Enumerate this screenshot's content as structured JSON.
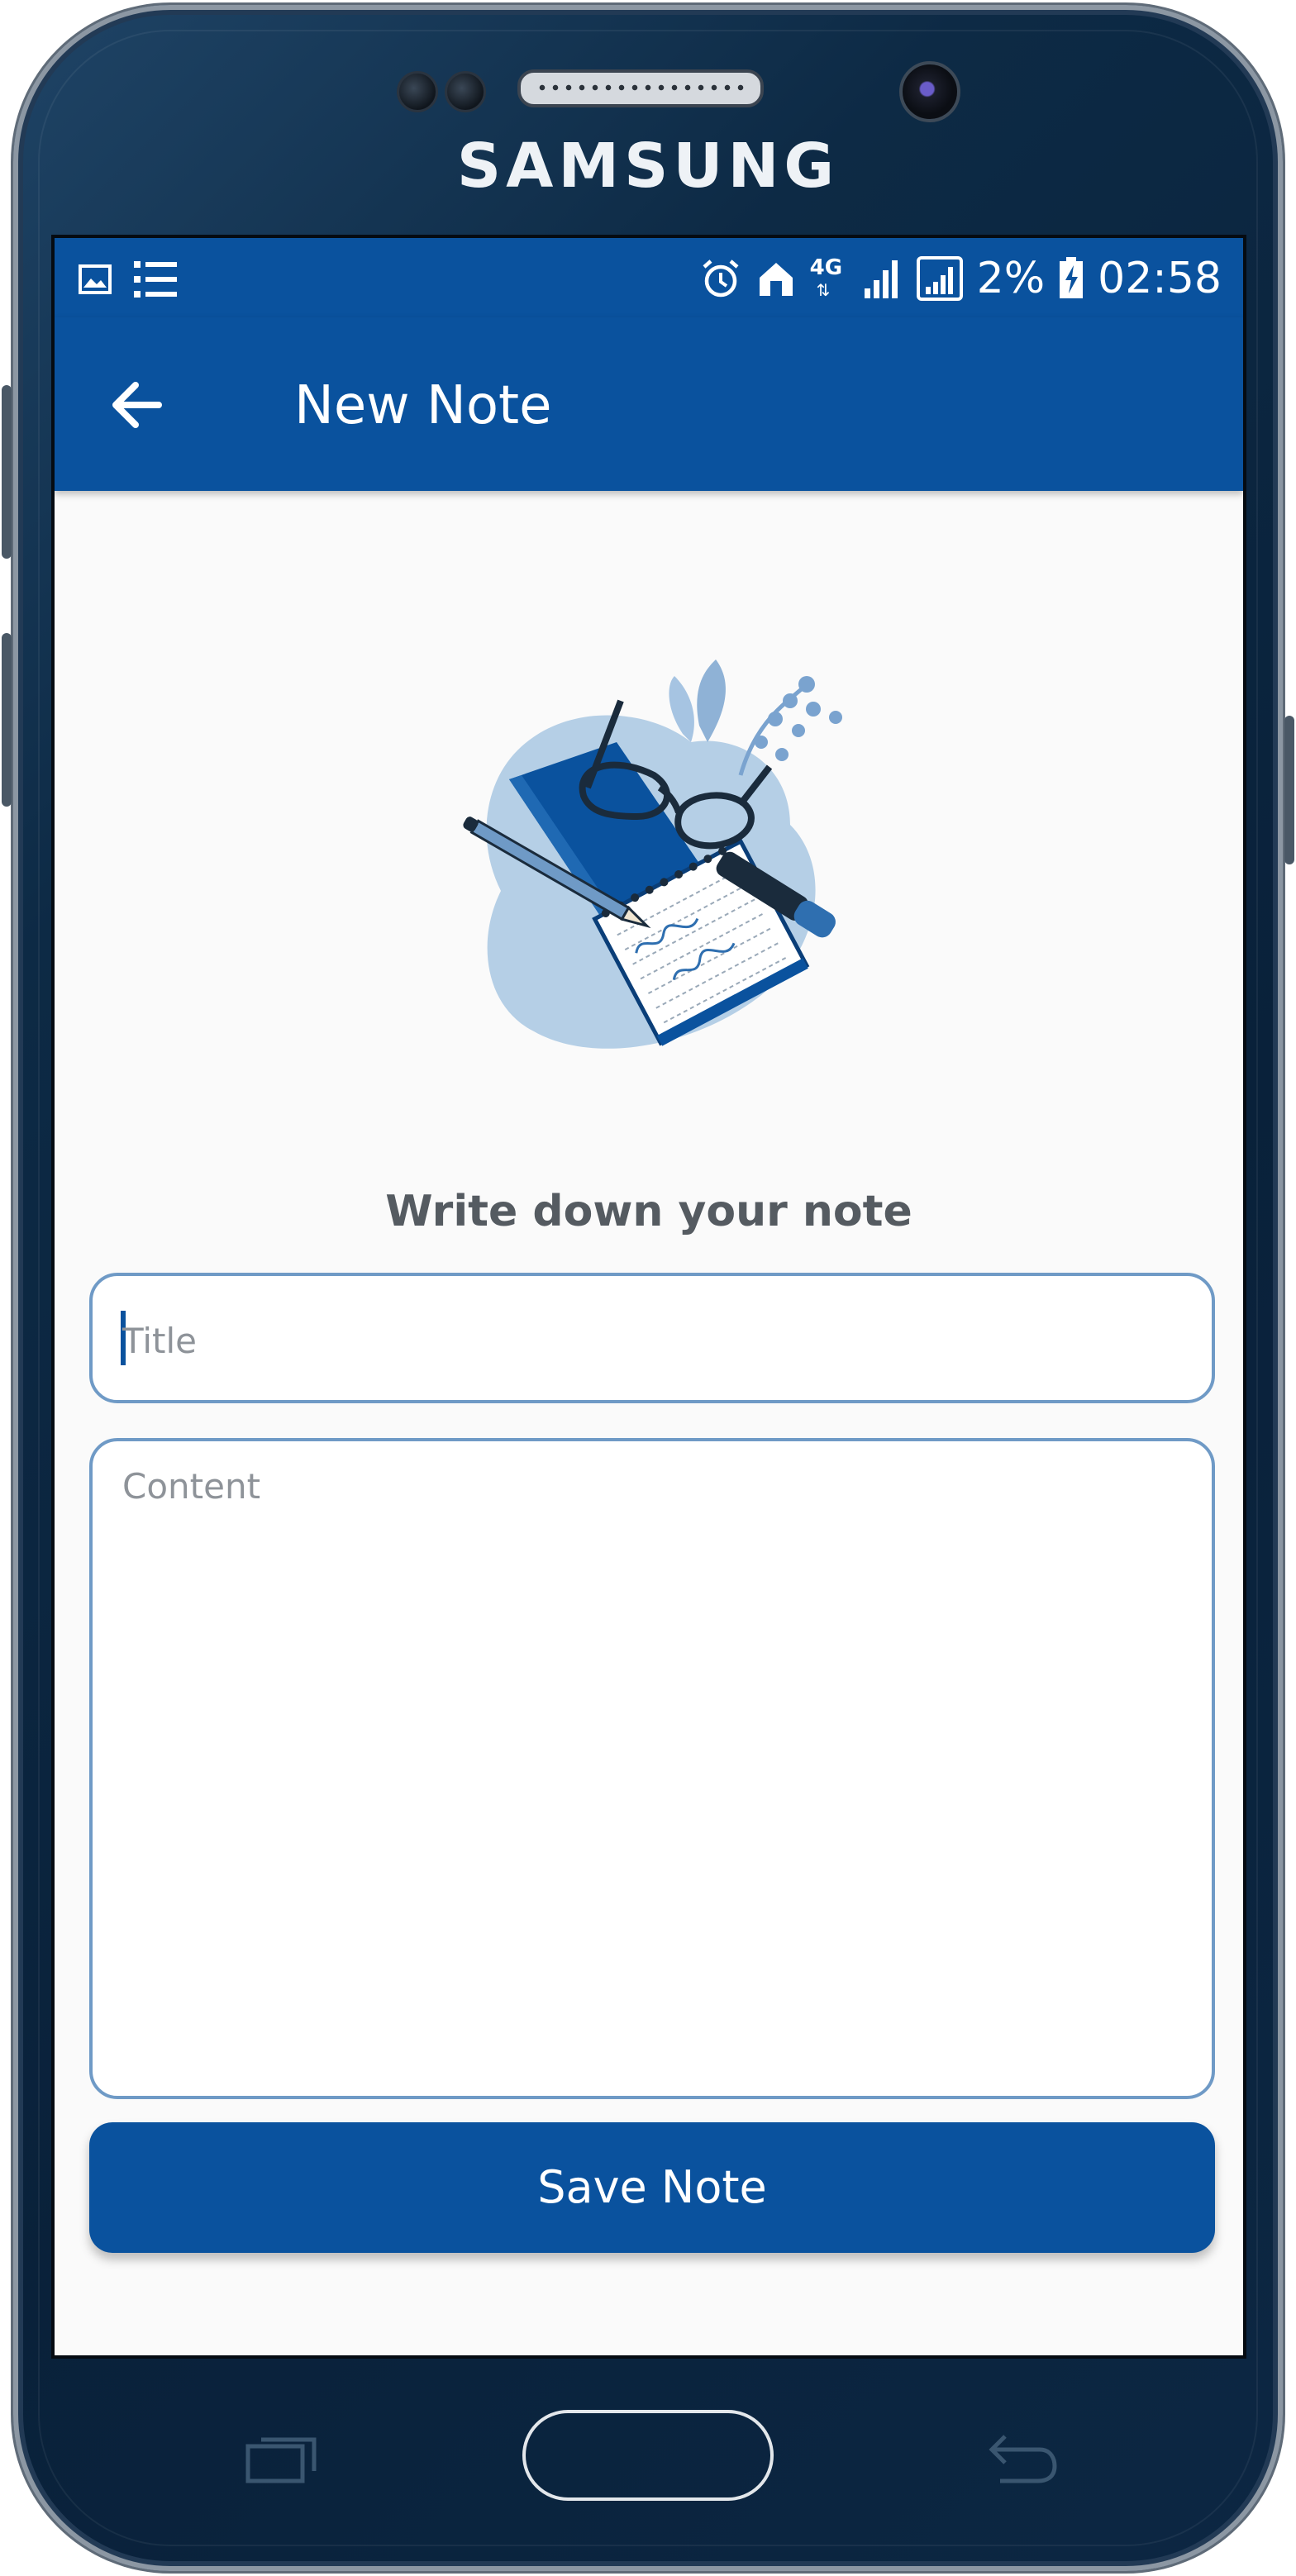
{
  "device": {
    "brand": "SAMSUNG"
  },
  "status_bar": {
    "left_icons": [
      "image-icon",
      "list-icon"
    ],
    "right_icons": [
      "alarm-icon",
      "home-icon",
      "4g-icon",
      "signal-icon",
      "signal-box-icon",
      "battery-charging-icon"
    ],
    "network": "4G",
    "battery": "2%",
    "time": "02:58"
  },
  "appbar": {
    "back_icon": "arrow-left-icon",
    "title": "New Note"
  },
  "main": {
    "illustration": "notebook-glasses-illustration",
    "headline": "Write down your note",
    "title_field": {
      "value": "",
      "placeholder": "Title"
    },
    "content_field": {
      "value": "",
      "placeholder": "Content"
    },
    "save_button": "Save Note"
  },
  "nav_keys": [
    "recent-apps-icon",
    "home-button",
    "back-icon"
  ],
  "colors": {
    "primary": "#0a529e",
    "field_border": "#6f9ac6",
    "background": "#fafafa",
    "headline": "#555b61",
    "placeholder": "#8e9399"
  }
}
